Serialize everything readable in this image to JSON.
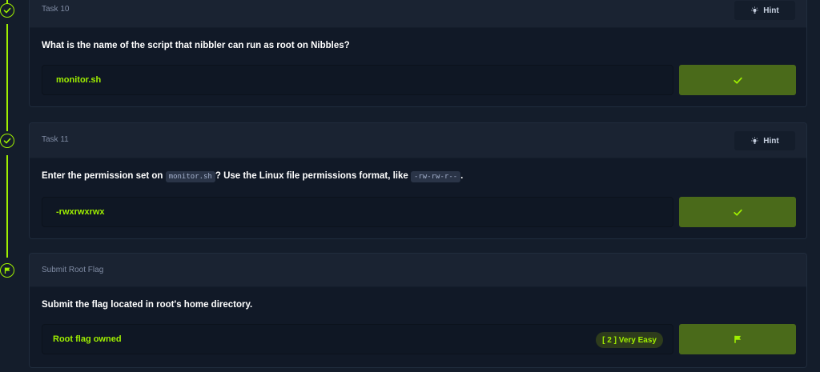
{
  "colors": {
    "accent": "#9fef00",
    "background": "#141d2b",
    "card": "#1a2332",
    "card_body": "#111927",
    "submit_bg": "#4a6a1a"
  },
  "tasks": [
    {
      "title": "Task 10",
      "hint_label": "Hint",
      "hint_icon": "lightbulb-icon",
      "question": "What is the name of the script that nibbler can run as root on Nibbles?",
      "answer": "monitor.sh",
      "submit_icon": "check-icon",
      "status_icon": "check-icon"
    },
    {
      "title": "Task 11",
      "hint_label": "Hint",
      "hint_icon": "lightbulb-icon",
      "question_part1": "Enter the permission set on",
      "question_code1": "monitor.sh",
      "question_part2": "? Use the Linux file permissions format, like",
      "question_code2": "-rw-rw-r--",
      "question_part3": ".",
      "answer": "-rwxrwxrwx",
      "submit_icon": "check-icon",
      "status_icon": "check-icon"
    },
    {
      "title": "Submit Root Flag",
      "question": "Submit the flag located in root's home directory.",
      "answer": "Root flag owned",
      "difficulty_badge": "[ 2 ] Very Easy",
      "submit_icon": "flag-icon",
      "status_icon": "flag-icon"
    }
  ]
}
